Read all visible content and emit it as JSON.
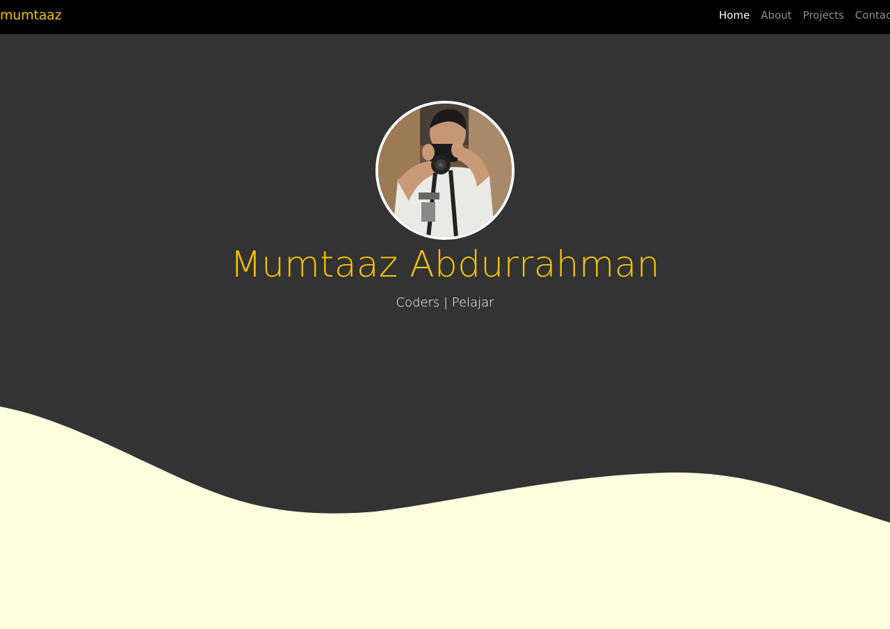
{
  "navbar": {
    "brand": "mumtaaz",
    "links": [
      {
        "label": "Home",
        "active": true
      },
      {
        "label": "About",
        "active": false
      },
      {
        "label": "Projects",
        "active": false
      },
      {
        "label": "Contact",
        "active": false
      }
    ]
  },
  "hero": {
    "name": "Mumtaaz Abdurrahman",
    "tagline": "Coders | Pelajar",
    "avatar_icon": "profile-photo"
  },
  "colors": {
    "navbar_bg": "#000000",
    "hero_bg": "#333333",
    "accent": "#f5c400",
    "wave": "#ffffe0",
    "nav_inactive": "#8d8d8d",
    "nav_active": "#ffffff"
  }
}
